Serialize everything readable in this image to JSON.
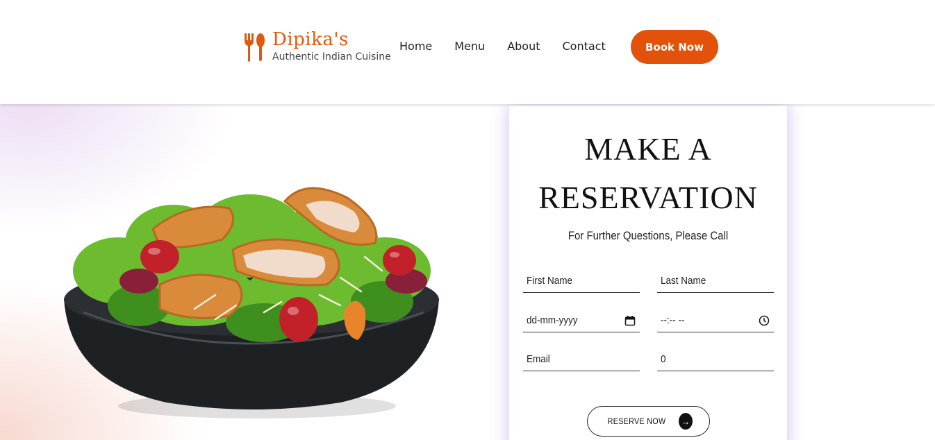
{
  "header": {
    "logo": {
      "name": "Dipika's",
      "tagline": "Authentic Indian Cuisine",
      "icon": "fork-spoon-icon"
    },
    "nav": [
      "Home",
      "Menu",
      "About",
      "Contact"
    ],
    "cta_label": "Book Now"
  },
  "colors": {
    "brand": "#e2520a",
    "text": "#222222",
    "card_glow": "#b48ce6"
  },
  "hero": {
    "image": "salad-bowl"
  },
  "reservation": {
    "title_line1": "MAKE A",
    "title_line2": "RESERVATION",
    "subtitle": "For Further Questions, Please Call",
    "fields": {
      "first_name": "First Name",
      "last_name": "Last Name",
      "date": "dd-mm-yyyy",
      "time": "--:-- --",
      "email": "Email",
      "guests": "0"
    },
    "submit_label": "RESERVE NOW"
  }
}
